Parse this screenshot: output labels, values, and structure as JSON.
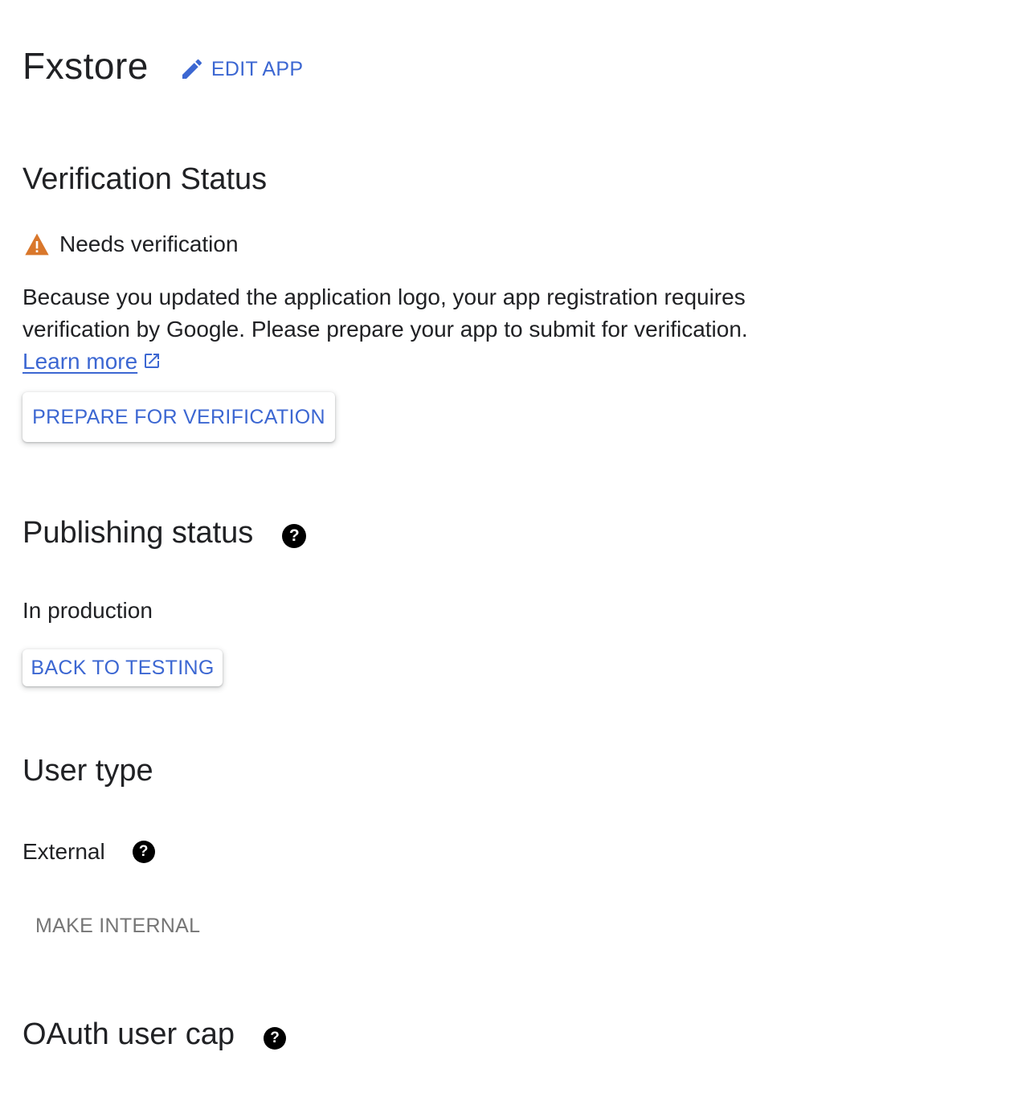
{
  "header": {
    "app_name": "Fxstore",
    "edit_label": "EDIT APP"
  },
  "verification": {
    "heading": "Verification Status",
    "status": "Needs verification",
    "description_line1": "Because you updated the application logo, your app registration requires",
    "description_line2": "verification by Google. Please prepare your app to submit for verification.",
    "learn_more": "Learn more",
    "button_label": "PREPARE FOR VERIFICATION",
    "warning_color": "#d9772b"
  },
  "publishing": {
    "heading": "Publishing status",
    "status": "In production",
    "button_label": "BACK TO TESTING"
  },
  "user_type": {
    "heading": "User type",
    "value": "External",
    "button_label": "MAKE INTERNAL"
  },
  "oauth": {
    "heading": "OAuth user cap"
  },
  "help_glyph": "?",
  "accent_color": "#3c67d2"
}
